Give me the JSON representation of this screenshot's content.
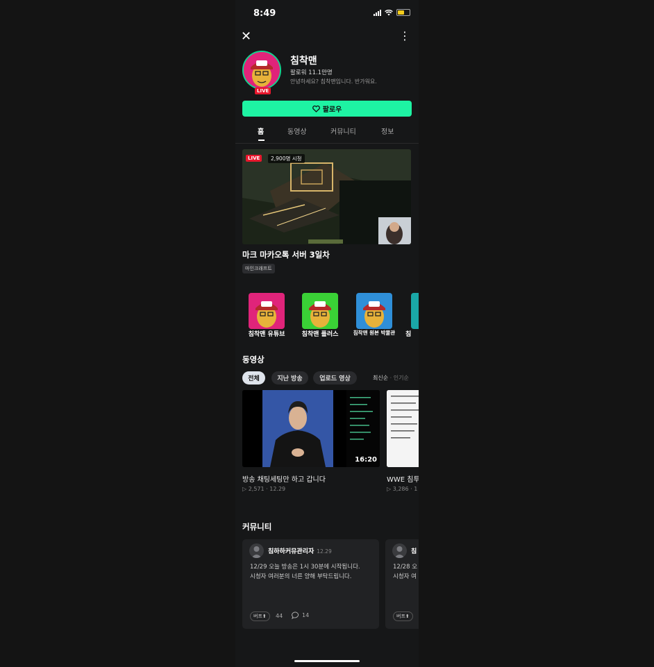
{
  "status": {
    "time": "8:49"
  },
  "channel": {
    "name": "침착맨",
    "followers": "팔로워 11.1만명",
    "bio": "안녕하세요? 침착맨입니다. 반가워요.",
    "live_badge": "LIVE",
    "follow_label": "팔로우"
  },
  "tabs": [
    "홈",
    "동영상",
    "커뮤니티",
    "정보"
  ],
  "live": {
    "tag": "LIVE",
    "viewers": "2,900명 시청",
    "title": "마크 마카오톡 서버 3일차",
    "category": "마인크래프트"
  },
  "related_channels": [
    {
      "label": "침착맨 유튜브",
      "color": "#e0247a"
    },
    {
      "label": "침착맨 플러스",
      "color": "#3ad136"
    },
    {
      "label": "침착맨 원본 박물관",
      "color": "#2f8fd8"
    },
    {
      "label": "침",
      "color": "#1aa7a7"
    }
  ],
  "videos": {
    "heading": "동영상",
    "filters": [
      "전체",
      "지난 방송",
      "업로드 영상"
    ],
    "sort_active": "최신순",
    "sort_sep": " · ",
    "sort_other": "인기순",
    "items": [
      {
        "title": "방송 채팅세팅만 하고 갑니다",
        "meta": "▷ 2,571 · 12.29",
        "duration": "16:20"
      },
      {
        "title": "WWE 침투",
        "meta": "▷ 3,286 · 1"
      }
    ]
  },
  "community": {
    "heading": "커뮤니티",
    "posts": [
      {
        "author": "침하하커뮤관리자",
        "date": "12.29",
        "line1": "12/29 오늘 방송은 1시 30분에 시작됩니다.",
        "line2": "시청자 여러분의 너른 양해 부탁드립니다.",
        "badge": "버프⬆",
        "likes": "44",
        "comments": "14"
      },
      {
        "author": "침",
        "date": "",
        "line1": "12/28 오",
        "line2": "시청자 여",
        "badge": "버프⬆",
        "likes": "",
        "comments": ""
      }
    ]
  },
  "colors": {
    "accent": "#1ef3a3",
    "live": "#e8172d"
  }
}
